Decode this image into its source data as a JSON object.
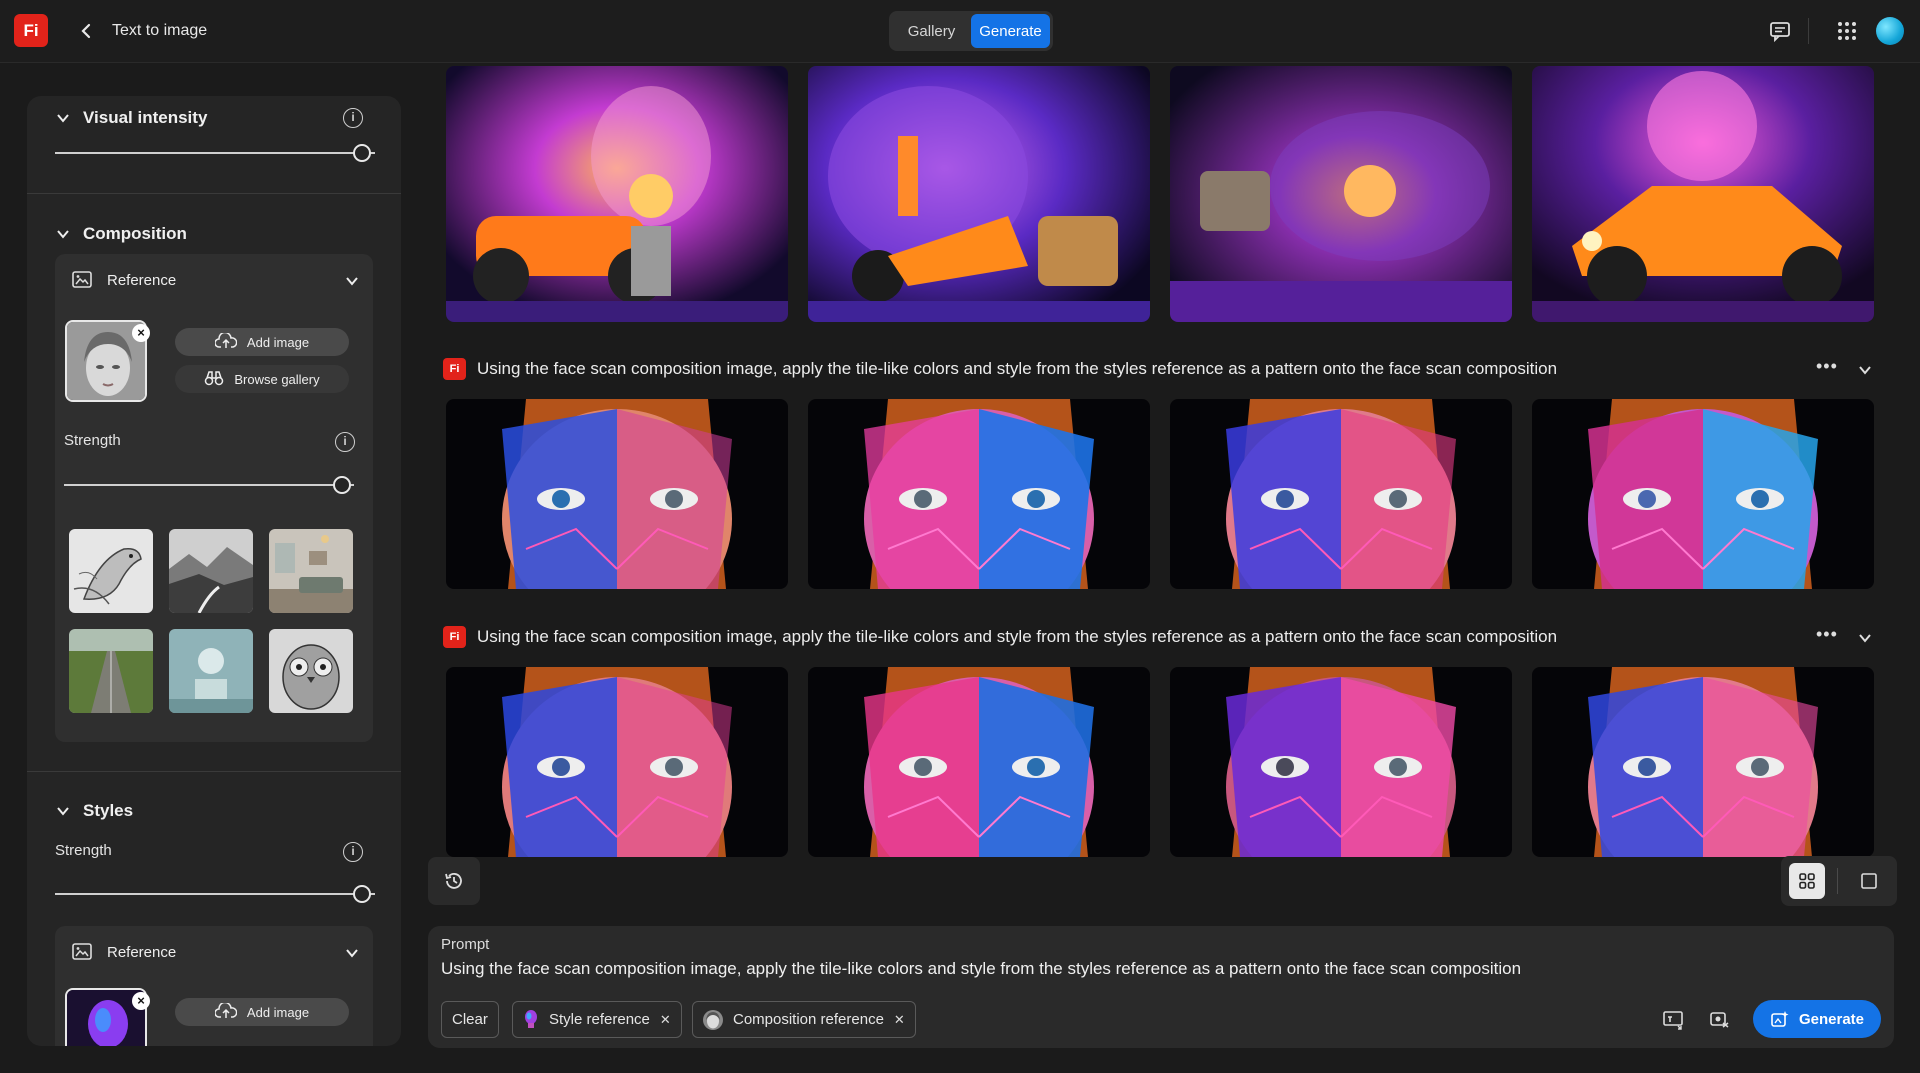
{
  "topbar": {
    "logo": "Fi",
    "title": "Text to image",
    "tabs": [
      "Gallery",
      "Generate"
    ],
    "active_tab": "Generate"
  },
  "sidebar": {
    "visual_intensity": {
      "title": "Visual intensity",
      "value": 1.0
    },
    "composition": {
      "title": "Composition",
      "reference_label": "Reference",
      "add_image": "Add image",
      "browse_gallery": "Browse gallery",
      "strength_label": "Strength",
      "strength_value": 1.0
    },
    "styles": {
      "title": "Styles",
      "strength_label": "Strength",
      "strength_value": 1.0,
      "reference_label": "Reference",
      "add_image": "Add image"
    }
  },
  "rows": [
    {
      "prompt": "Using the face scan composition image, apply the tile-like colors and style from the styles reference as a pattern onto the face scan composition"
    },
    {
      "prompt": "Using the face scan composition image, apply the tile-like colors and style from the styles reference as a pattern onto the face scan composition"
    }
  ],
  "prompt_box": {
    "label": "Prompt",
    "text": "Using the face scan composition image, apply the tile-like colors and style from the styles reference as a pattern onto the face scan composition",
    "clear": "Clear",
    "style_chip": "Style reference",
    "composition_chip": "Composition reference",
    "generate": "Generate"
  },
  "colors": {
    "accent": "#1473e6",
    "brand": "#e2231a"
  }
}
